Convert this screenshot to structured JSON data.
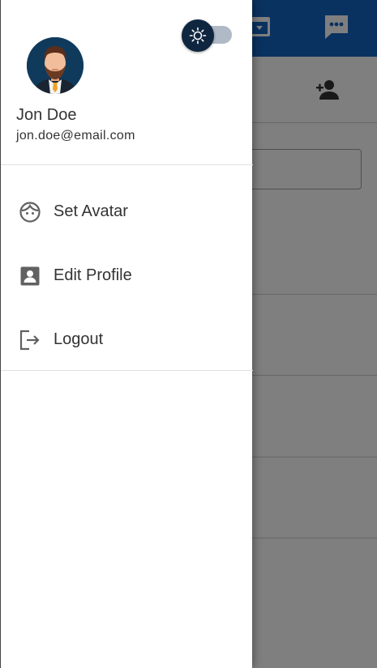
{
  "app": {
    "icons": {
      "archive": "archive-icon",
      "chat": "chat-icon",
      "add_contact": "person-add-icon"
    },
    "colors": {
      "app_bar": "#1565c0",
      "scrim": "rgba(0,0,0,0.5)"
    }
  },
  "drawer": {
    "theme_toggle": {
      "icon": "sun-icon",
      "state": "light"
    },
    "user": {
      "name": "Jon Doe",
      "email": "jon.doe@email.com",
      "avatar": "avatar-image"
    },
    "menu": [
      {
        "label": "Set Avatar",
        "icon": "face-icon"
      },
      {
        "label": "Edit Profile",
        "icon": "account-box-icon"
      },
      {
        "label": "Logout",
        "icon": "logout-icon"
      }
    ]
  }
}
